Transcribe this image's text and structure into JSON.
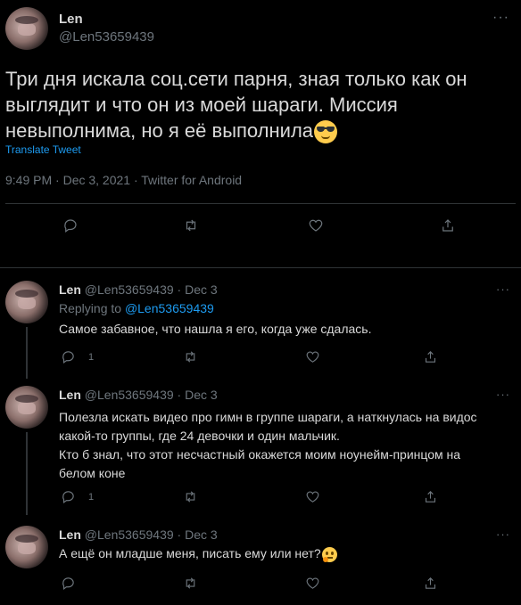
{
  "main_tweet": {
    "name": "Len",
    "handle": "@Len53659439",
    "text": "Три дня искала соц.сети парня, зная только как он выглядит и что он из моей шараги. Миссия невыполнима, но я её выполнила",
    "translate": "Translate Tweet",
    "meta": "9:49 PM · Dec 3, 2021 · Twitter for Android",
    "more": "···"
  },
  "replies": [
    {
      "name": "Len",
      "handle": "@Len53659439",
      "date": "· Dec 3",
      "replying_prefix": "Replying to ",
      "replying_handle": "@Len53659439",
      "text": "Самое забавное, что нашла я его, когда уже сдалась.",
      "reply_count": "1",
      "more": "···"
    },
    {
      "name": "Len",
      "handle": "@Len53659439",
      "date": "· Dec 3",
      "text_lines": [
        "Полезла искать видео про гимн в группе шараги, а наткнулась на видос",
        "какой-то группы, где 24 девочки и один мальчик.",
        "Кто б знал, что этот несчастный окажется моим ноунейм-принцом на",
        "белом коне"
      ],
      "reply_count": "1",
      "more": "···"
    },
    {
      "name": "Len",
      "handle": "@Len53659439",
      "date": "· Dec 3",
      "text": "А ещё он младше меня, писать ему или нет?",
      "more": "···"
    }
  ],
  "icons": [
    "reply-icon",
    "retweet-icon",
    "like-icon",
    "share-icon",
    "more-icon",
    "sunglasses-emoji",
    "thinking-emoji"
  ],
  "colors": {
    "background": "#000000",
    "text": "#d9d9d9",
    "muted": "#6e767d",
    "link": "#1d9bf0",
    "divider": "#2f3336"
  }
}
